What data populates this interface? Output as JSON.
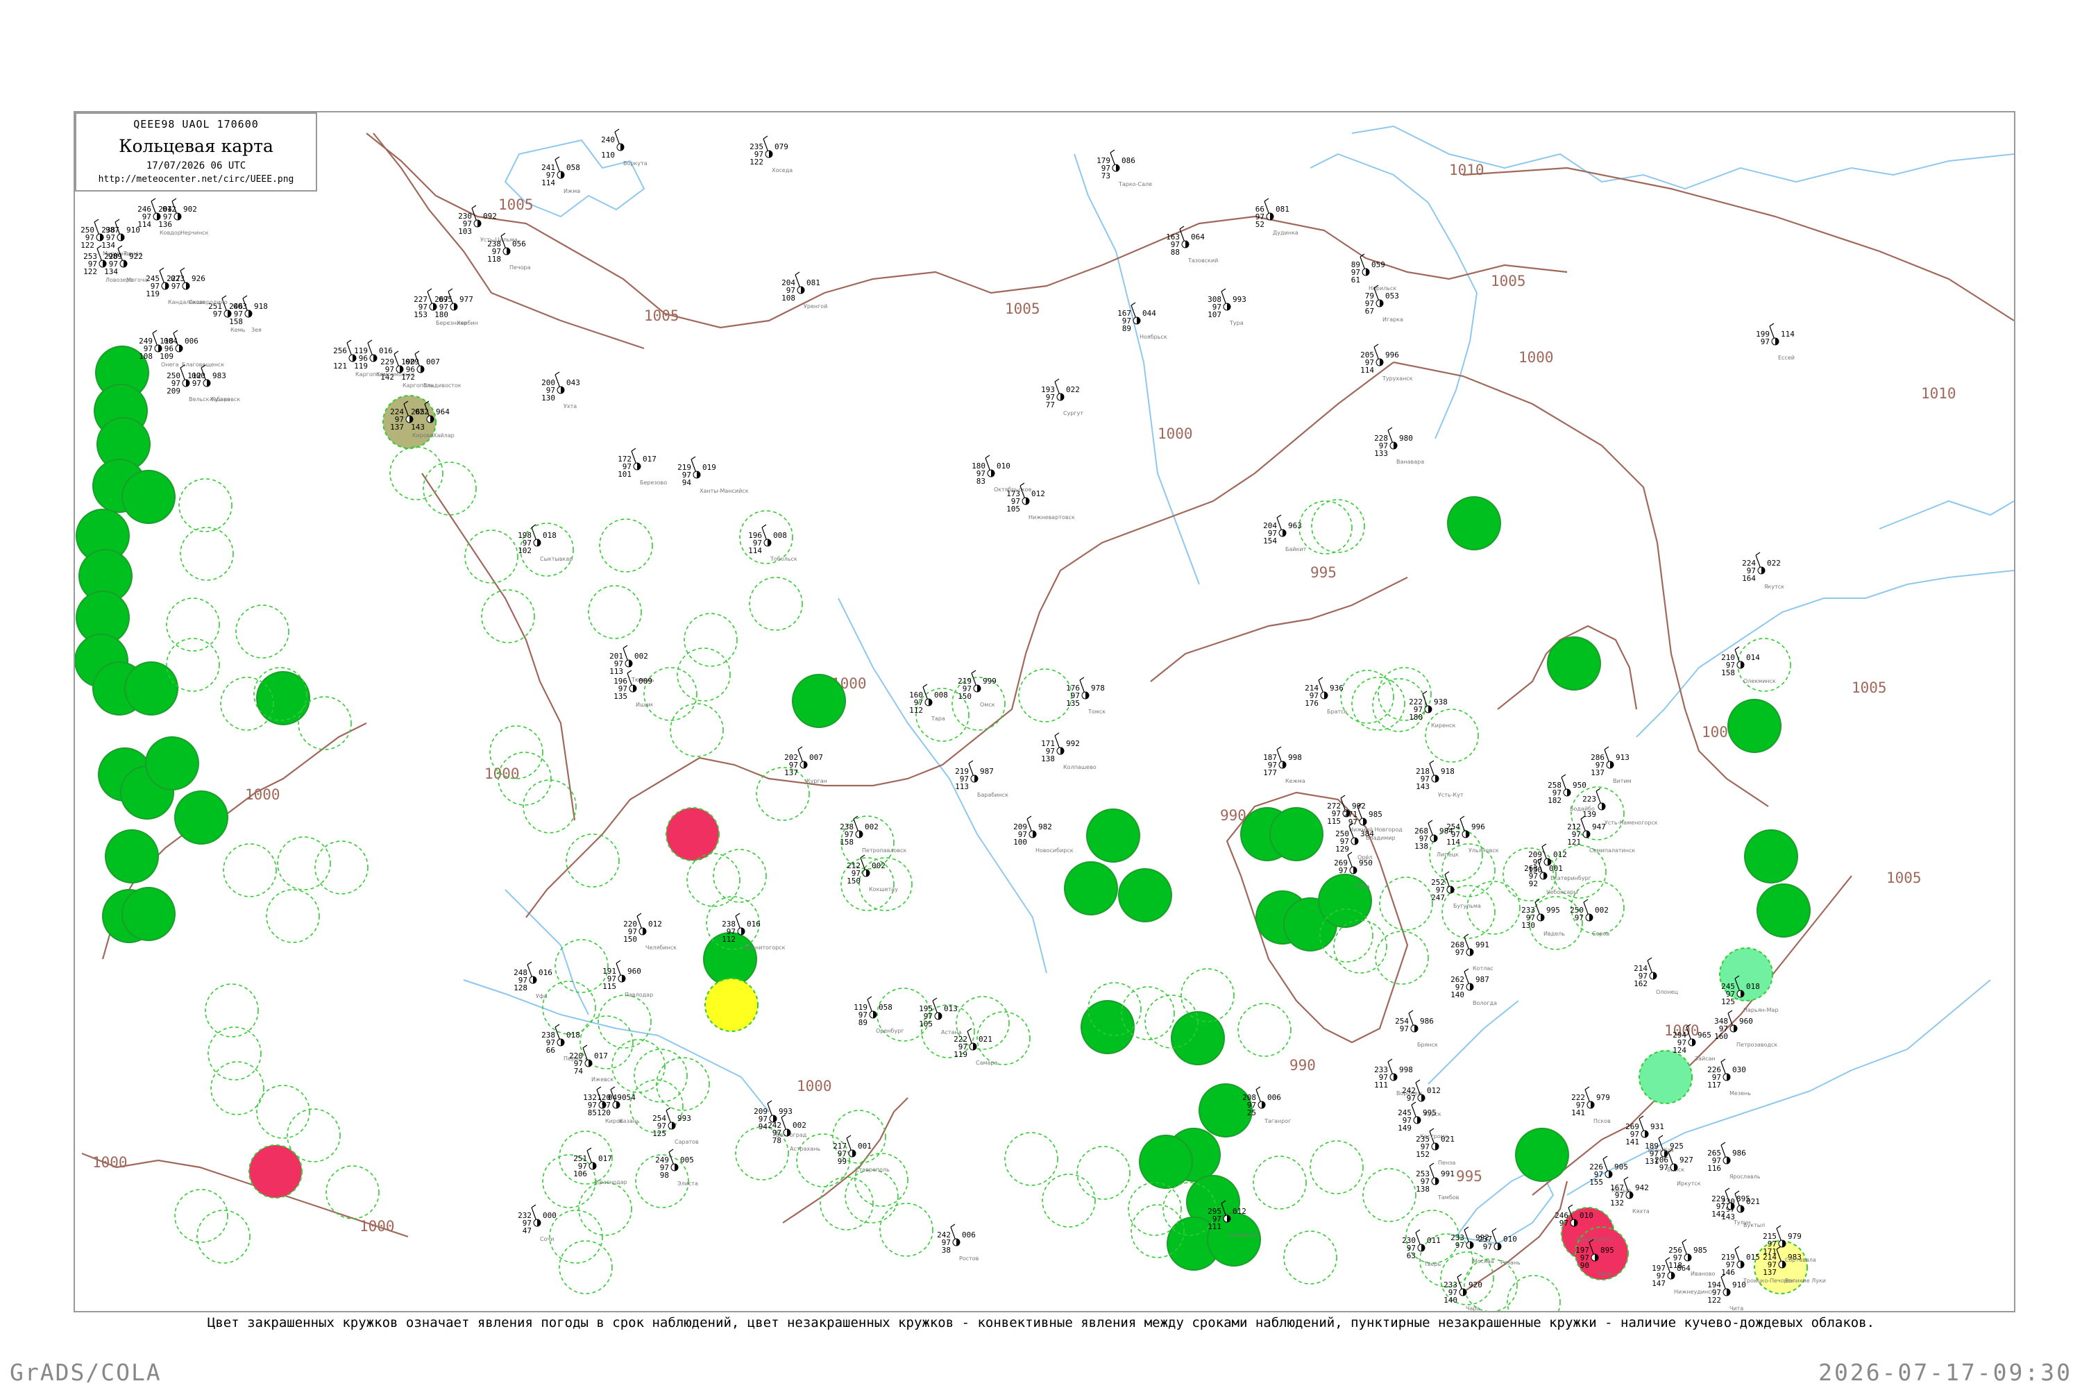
{
  "title": {
    "code": "QEEE98  UAOL  170600",
    "main": "Кольцевая карта",
    "time": "17/07/2026 06 UTC",
    "url": "http://meteocenter.net/circ/UEEE.png"
  },
  "caption": "Цвет закрашенных кружков означает явления погоды в срок наблюдений, цвет незакрашенных кружков - конвективные явления между сроками наблюдений, пунктирные незакрашенные кружки - наличие кучево-дождевых облаков.",
  "footer": {
    "left": "GrADS/COLA",
    "right": "2026-07-17-09:30"
  },
  "colors": {
    "isobar": "#a0685a",
    "river": "#8ec8ee",
    "green_fill": "#00c020",
    "green_ring": "#1a9e2a",
    "red_fill": "#f03060",
    "yellow_fill": "#ffff20",
    "pale_yellow_fill": "#ffff90",
    "olive_fill": "#b4b47a",
    "light_green_fill": "#70f0a0",
    "dashed_ring": "#33cc33"
  },
  "isobar_labels": [
    {
      "text": "1010"
    },
    {
      "text": "1005"
    },
    {
      "text": "1005"
    },
    {
      "text": "1005"
    },
    {
      "text": "1005"
    },
    {
      "text": "1005"
    },
    {
      "text": "1005"
    },
    {
      "text": "1000"
    },
    {
      "text": "1000"
    },
    {
      "text": "1000"
    },
    {
      "text": "1000"
    },
    {
      "text": "1000"
    },
    {
      "text": "1000"
    },
    {
      "text": "1000"
    },
    {
      "text": "1000"
    },
    {
      "text": "1000"
    },
    {
      "text": "1000"
    },
    {
      "text": "995"
    },
    {
      "text": "995"
    },
    {
      "text": "995"
    },
    {
      "text": "990"
    },
    {
      "text": "990"
    },
    {
      "text": "1010"
    }
  ],
  "stations": [
    {
      "t": "250",
      "p": "987",
      "w": "97",
      "d": "122",
      "name": "Мурманск"
    },
    {
      "t": "253",
      "p": "989",
      "w": "97",
      "d": "122",
      "name": "Ловозеро"
    },
    {
      "t": "246",
      "p": "012",
      "w": "97",
      "d": "114",
      "name": "Ковдор"
    },
    {
      "t": "245",
      "p": "023",
      "w": "97",
      "d": "119",
      "name": "Кандалакша"
    },
    {
      "t": "251",
      "p": "003",
      "w": "97",
      "d": "",
      "name": "Кемь"
    },
    {
      "t": "249",
      "p": "004",
      "w": "97",
      "d": "108",
      "name": "Онега"
    },
    {
      "t": "250",
      "p": "000",
      "w": "97",
      "d": "209",
      "name": "Вельск-Кушка"
    },
    {
      "t": "256",
      "p": "",
      "w": "",
      "d": "121",
      "name": "Каргополь"
    },
    {
      "t": "229",
      "p": "029",
      "w": "97",
      "d": "142",
      "name": "Каргополь"
    },
    {
      "t": "224",
      "p": "022",
      "w": "97",
      "d": "137",
      "name": "Кирово"
    },
    {
      "t": "227",
      "p": "095",
      "w": "97",
      "d": "153",
      "name": "Березники"
    },
    {
      "t": "230",
      "p": "092",
      "w": "97",
      "d": "103",
      "name": "Усть-Цильма"
    },
    {
      "t": "238",
      "p": "056",
      "w": "97",
      "d": "118",
      "name": "Печора"
    },
    {
      "t": "241",
      "p": "058",
      "w": "97",
      "d": "114",
      "name": "Ижма"
    },
    {
      "t": "240",
      "p": "",
      "w": "",
      "d": "110",
      "name": "Воркута"
    },
    {
      "t": "235",
      "p": "079",
      "w": "97",
      "d": "122",
      "name": "Хоседа"
    },
    {
      "t": "179",
      "p": "086",
      "w": "97",
      "d": "73",
      "name": "Тарко-Сале"
    },
    {
      "t": "204",
      "p": "081",
      "w": "97",
      "d": "108",
      "name": "Уренгой"
    },
    {
      "t": "163",
      "p": "064",
      "w": "97",
      "d": "88",
      "name": "Тазовский"
    },
    {
      "t": "66",
      "p": "081",
      "w": "97",
      "d": "52",
      "name": "Дудинка"
    },
    {
      "t": "89",
      "p": "059",
      "w": "97",
      "d": "61",
      "name": "Норильск"
    },
    {
      "t": "79",
      "p": "053",
      "w": "97",
      "d": "67",
      "name": "Игарка"
    },
    {
      "t": "205",
      "p": "996",
      "w": "97",
      "d": "114",
      "name": "Туруханск"
    },
    {
      "t": "199",
      "p": "114",
      "w": "97",
      "d": "",
      "name": "Ессей"
    },
    {
      "t": "308",
      "p": "993",
      "w": "97",
      "d": "107",
      "name": "Тура"
    },
    {
      "t": "167",
      "p": "044",
      "w": "97",
      "d": "89",
      "name": "Ноябрьск"
    },
    {
      "t": "193",
      "p": "022",
      "w": "97",
      "d": "77",
      "name": "Сургут"
    },
    {
      "t": "228",
      "p": "980",
      "w": "97",
      "d": "133",
      "name": "Ванавара"
    },
    {
      "t": "200",
      "p": "043",
      "w": "97",
      "d": "130",
      "name": "Ухта"
    },
    {
      "t": "172",
      "p": "017",
      "w": "97",
      "d": "101",
      "name": "Березово"
    },
    {
      "t": "219",
      "p": "019",
      "w": "97",
      "d": "94",
      "name": "Ханты-Мансийск"
    },
    {
      "t": "180",
      "p": "010",
      "w": "97",
      "d": "83",
      "name": "Октябрьское"
    },
    {
      "t": "173",
      "p": "012",
      "w": "97",
      "d": "105",
      "name": "Нижневартовск"
    },
    {
      "t": "204",
      "p": "963",
      "w": "97",
      "d": "154",
      "name": "Байкит"
    },
    {
      "t": "196",
      "p": "008",
      "w": "97",
      "d": "114",
      "name": "Тобольск"
    },
    {
      "t": "198",
      "p": "018",
      "w": "97",
      "d": "102",
      "name": "Сыктывкар"
    },
    {
      "t": "201",
      "p": "002",
      "w": "97",
      "d": "113",
      "name": "Тюмень"
    },
    {
      "t": "196",
      "p": "009",
      "w": "97",
      "d": "135",
      "name": "Ишим"
    },
    {
      "t": "160",
      "p": "008",
      "w": "97",
      "d": "112",
      "name": "Тара"
    },
    {
      "t": "219",
      "p": "999",
      "w": "97",
      "d": "150",
      "name": "Омск"
    },
    {
      "t": "171",
      "p": "992",
      "w": "97",
      "d": "138",
      "name": "Колпашево"
    },
    {
      "t": "176",
      "p": "978",
      "w": "97",
      "d": "135",
      "name": "Томск"
    },
    {
      "t": "187",
      "p": "998",
      "w": "97",
      "d": "177",
      "name": "Кежма"
    },
    {
      "t": "214",
      "p": "936",
      "w": "97",
      "d": "176",
      "name": "Братск"
    },
    {
      "t": "222",
      "p": "938",
      "w": "97",
      "d": "180",
      "name": "Киренск"
    },
    {
      "t": "218",
      "p": "918",
      "w": "97",
      "d": "143",
      "name": "Усть-Кут"
    },
    {
      "t": "258",
      "p": "950",
      "w": "97",
      "d": "182",
      "name": "Бодайбо"
    },
    {
      "t": "286",
      "p": "913",
      "w": "97",
      "d": "137",
      "name": "Витим"
    },
    {
      "t": "210",
      "p": "014",
      "w": "97",
      "d": "158",
      "name": "Олекминск"
    },
    {
      "t": "224",
      "p": "022",
      "w": "97",
      "d": "164",
      "name": "Якутск"
    },
    {
      "t": "219",
      "p": "987",
      "w": "97",
      "d": "113",
      "name": "Барабинск"
    },
    {
      "t": "209",
      "p": "982",
      "w": "97",
      "d": "100",
      "name": "Новосибирск"
    },
    {
      "t": "202",
      "p": "007",
      "w": "97",
      "d": "137",
      "name": "Курган"
    },
    {
      "t": "238",
      "p": "002",
      "w": "97",
      "d": "158",
      "name": "Петропавловск"
    },
    {
      "t": "212",
      "p": "002",
      "w": "97",
      "d": "150",
      "name": "Кокшетау"
    },
    {
      "t": "220",
      "p": "012",
      "w": "97",
      "d": "150",
      "name": "Челябинск"
    },
    {
      "t": "238",
      "p": "016",
      "w": "97",
      "d": "112",
      "name": "Магнитогорск"
    },
    {
      "t": "119",
      "p": "058",
      "w": "97",
      "d": "89",
      "name": "Оренбург"
    },
    {
      "t": "195",
      "p": "013",
      "w": "97",
      "d": "105",
      "name": "Астана"
    },
    {
      "t": "191",
      "p": "960",
      "w": "97",
      "d": "115",
      "name": "Павлодар"
    },
    {
      "t": "248",
      "p": "016",
      "w": "97",
      "d": "128",
      "name": "Уфа"
    },
    {
      "t": "238",
      "p": "018",
      "w": "97",
      "d": "66",
      "name": "Пермь"
    },
    {
      "t": "220",
      "p": "017",
      "w": "97",
      "d": "74",
      "name": "Ижевск"
    },
    {
      "t": "132",
      "p": "049",
      "w": "97",
      "d": "85",
      "name": "Киров"
    },
    {
      "t": "120",
      "p": "054",
      "w": "97",
      "d": "120",
      "name": "Казань"
    },
    {
      "t": "222",
      "p": "021",
      "w": "97",
      "d": "119",
      "name": "Самара"
    },
    {
      "t": "254",
      "p": "993",
      "w": "97",
      "d": "125",
      "name": "Саратов"
    },
    {
      "t": "209",
      "p": "993",
      "w": "97",
      "d": "94",
      "name": "Волгоград"
    },
    {
      "t": "242",
      "p": "002",
      "w": "97",
      "d": "78",
      "name": "Астрахань"
    },
    {
      "t": "249",
      "p": "005",
      "w": "97",
      "d": "98",
      "name": "Элиста"
    },
    {
      "t": "217",
      "p": "001",
      "w": "97",
      "d": "99",
      "name": "Ставрополь"
    },
    {
      "t": "251",
      "p": "017",
      "w": "97",
      "d": "106",
      "name": "Краснодар"
    },
    {
      "t": "232",
      "p": "000",
      "w": "97",
      "d": "47",
      "name": "Сочи"
    },
    {
      "t": "242",
      "p": "006",
      "w": "97",
      "d": "38",
      "name": "Ростов"
    },
    {
      "t": "208",
      "p": "006",
      "w": "97",
      "d": "25",
      "name": "Таганрог"
    },
    {
      "t": "295",
      "p": "012",
      "w": "97",
      "d": "111",
      "name": "Смоленск"
    },
    {
      "t": "230",
      "p": "011",
      "w": "97",
      "d": "63",
      "name": "Тверь"
    },
    {
      "t": "233",
      "p": "992",
      "w": "97",
      "d": "",
      "name": "Москва"
    },
    {
      "t": "237",
      "p": "010",
      "w": "97",
      "d": "",
      "name": "Рязань"
    },
    {
      "t": "253",
      "p": "991",
      "w": "97",
      "d": "138",
      "name": "Тамбов"
    },
    {
      "t": "235",
      "p": "021",
      "w": "97",
      "d": "152",
      "name": "Пенза"
    },
    {
      "t": "233",
      "p": "998",
      "w": "97",
      "d": "111",
      "name": "Воронеж"
    },
    {
      "t": "242",
      "p": "012",
      "w": "97",
      "d": "",
      "name": "Курск"
    },
    {
      "t": "254",
      "p": "986",
      "w": "97",
      "d": "",
      "name": "Брянск"
    },
    {
      "t": "262",
      "p": "987",
      "w": "97",
      "d": "140",
      "name": "Вологда"
    },
    {
      "t": "268",
      "p": "991",
      "w": "97",
      "d": "",
      "name": "Котлас"
    },
    {
      "t": "246",
      "p": "010",
      "w": "97",
      "d": "",
      "name": "Архангельск"
    },
    {
      "t": "226",
      "p": "030",
      "w": "97",
      "d": "117",
      "name": "Мезень"
    },
    {
      "t": "245",
      "p": "018",
      "w": "97",
      "d": "125",
      "name": "Нарьян-Мар"
    },
    {
      "t": "230",
      "p": "021",
      "w": "97",
      "d": "143",
      "name": "Вуктыл"
    },
    {
      "t": "219",
      "p": "015",
      "w": "97",
      "d": "146",
      "name": "Троицко-Печорск"
    },
    {
      "t": "214",
      "p": "983",
      "w": "97",
      "d": "137",
      "name": "Великие Луки"
    },
    {
      "t": "222",
      "p": "979",
      "w": "97",
      "d": "141",
      "name": "Псков"
    },
    {
      "t": "348",
      "p": "960",
      "w": "97",
      "d": "160",
      "name": "Петрозаводск"
    },
    {
      "t": "214",
      "p": "",
      "w": "97",
      "d": "162",
      "name": "Олонец"
    },
    {
      "t": "215",
      "p": "979",
      "w": "97",
      "d": "171",
      "name": "Сортавала"
    },
    {
      "t": "245",
      "p": "995",
      "w": "97",
      "d": "149",
      "name": "Кострома"
    },
    {
      "t": "256",
      "p": "985",
      "w": "97",
      "d": "118",
      "name": "Иваново"
    },
    {
      "t": "265",
      "p": "986",
      "w": "97",
      "d": "116",
      "name": "Ярославль"
    },
    {
      "t": "272",
      "p": "992",
      "w": "97",
      "d": "115",
      "name": "Нижний Новгород"
    },
    {
      "t": "271",
      "p": "985",
      "w": "97",
      "d": "",
      "name": "Владимир"
    },
    {
      "t": "269",
      "p": "950",
      "w": "97",
      "d": "",
      "name": "Тула"
    },
    {
      "t": "250",
      "p": "384",
      "w": "97",
      "d": "129",
      "name": "Орёл"
    },
    {
      "t": "268",
      "p": "984",
      "w": "97",
      "d": "138",
      "name": "Липецк"
    },
    {
      "t": "254",
      "p": "996",
      "w": "97",
      "d": "114",
      "name": "Ульяновск"
    },
    {
      "t": "263",
      "p": "001",
      "w": "97",
      "d": "92",
      "name": "Чебоксары"
    },
    {
      "t": "209",
      "p": "012",
      "w": "97",
      "d": "150",
      "name": "Екатеринбург"
    },
    {
      "t": "233",
      "p": "995",
      "w": "97",
      "d": "130",
      "name": "Ивдель"
    },
    {
      "t": "250",
      "p": "002",
      "w": "97",
      "d": "",
      "name": "Серов"
    },
    {
      "t": "252",
      "p": "",
      "w": "97",
      "d": "247",
      "name": "Бугульма"
    },
    {
      "t": "212",
      "p": "947",
      "w": "97",
      "d": "121",
      "name": "Семипалатинск"
    },
    {
      "t": "223",
      "p": "",
      "w": "",
      "d": "139",
      "name": "Усть-Каменогорск"
    },
    {
      "t": "294",
      "p": "965",
      "w": "97",
      "d": "124",
      "name": "Зайсан"
    },
    {
      "t": "189",
      "p": "925",
      "w": "97",
      "d": "131",
      "name": "Бийск"
    },
    {
      "t": "226",
      "p": "905",
      "w": "97",
      "d": "155",
      "name": "Кызыл"
    },
    {
      "t": "269",
      "p": "931",
      "w": "97",
      "d": "141",
      "name": "Улан-Удэ"
    },
    {
      "t": "206",
      "p": "927",
      "w": "97",
      "d": "",
      "name": "Иркутск"
    },
    {
      "t": "167",
      "p": "942",
      "w": "97",
      "d": "132",
      "name": "Кяхта"
    },
    {
      "t": "194",
      "p": "910",
      "w": "97",
      "d": "122",
      "name": "Чита"
    },
    {
      "t": "197",
      "p": "864",
      "w": "97",
      "d": "147",
      "name": "Нижнеудинск"
    },
    {
      "t": "229",
      "p": "895",
      "w": "97",
      "d": "142",
      "name": "Тулун"
    },
    {
      "t": "197",
      "p": "895",
      "w": "97",
      "d": "90",
      "name": "Зима"
    },
    {
      "t": "233",
      "p": "920",
      "w": "97",
      "d": "140",
      "name": "Чара"
    },
    {
      "t": "238",
      "p": "910",
      "w": "97",
      "d": "134",
      "name": "Тында"
    },
    {
      "t": "220",
      "p": "922",
      "w": "97",
      "d": "134",
      "name": "Могоча"
    },
    {
      "t": "204",
      "p": "902",
      "w": "97",
      "d": "136",
      "name": "Нерчинск"
    },
    {
      "t": "227",
      "p": "926",
      "w": "97",
      "d": "",
      "name": "Сковородино"
    },
    {
      "t": "246",
      "p": "918",
      "w": "97",
      "d": "158",
      "name": "Зея"
    },
    {
      "t": "118",
      "p": "006",
      "w": "96",
      "d": "109",
      "name": "Благовещенск"
    },
    {
      "t": "112",
      "p": "983",
      "w": "97",
      "d": "",
      "name": "Хабаровск"
    },
    {
      "t": "119",
      "p": "016",
      "w": "96",
      "d": "119",
      "name": "Комсомольск"
    },
    {
      "t": "190",
      "p": "007",
      "w": "96",
      "d": "172",
      "name": "Владивосток"
    },
    {
      "t": "265",
      "p": "964",
      "w": "",
      "d": "143",
      "name": "Хайлар"
    },
    {
      "t": "267",
      "p": "977",
      "w": "97",
      "d": "180",
      "name": "Харбин"
    }
  ]
}
